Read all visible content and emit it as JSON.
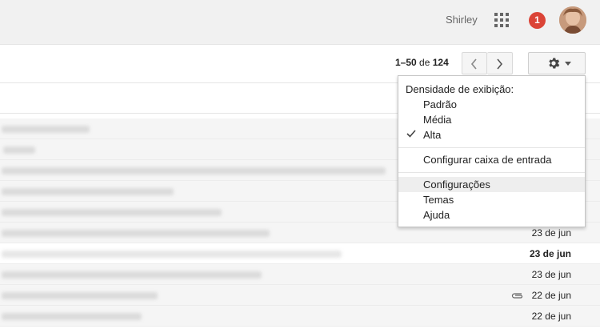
{
  "header": {
    "user_name": "Shirley",
    "notification_count": "1",
    "notification_color": "#db4437"
  },
  "toolbar": {
    "pager": {
      "range": "1–50",
      "of": "de",
      "total": "124"
    },
    "icons": {
      "prev": "chevron-left-icon",
      "next": "chevron-right-icon",
      "settings": "gear-icon"
    }
  },
  "settings_menu": {
    "heading": "Densidade de exibição:",
    "density_options": [
      "Padrão",
      "Média",
      "Alta"
    ],
    "selected_density": "Alta",
    "configure_inbox": "Configurar caixa de entrada",
    "settings": "Configurações",
    "themes": "Temas",
    "help": "Ajuda",
    "hovered": "Configurações"
  },
  "messages": {
    "dates": [
      "23 de jun",
      "23 de jun",
      "23 de jun",
      "22 de jun",
      "22 de jun"
    ]
  }
}
